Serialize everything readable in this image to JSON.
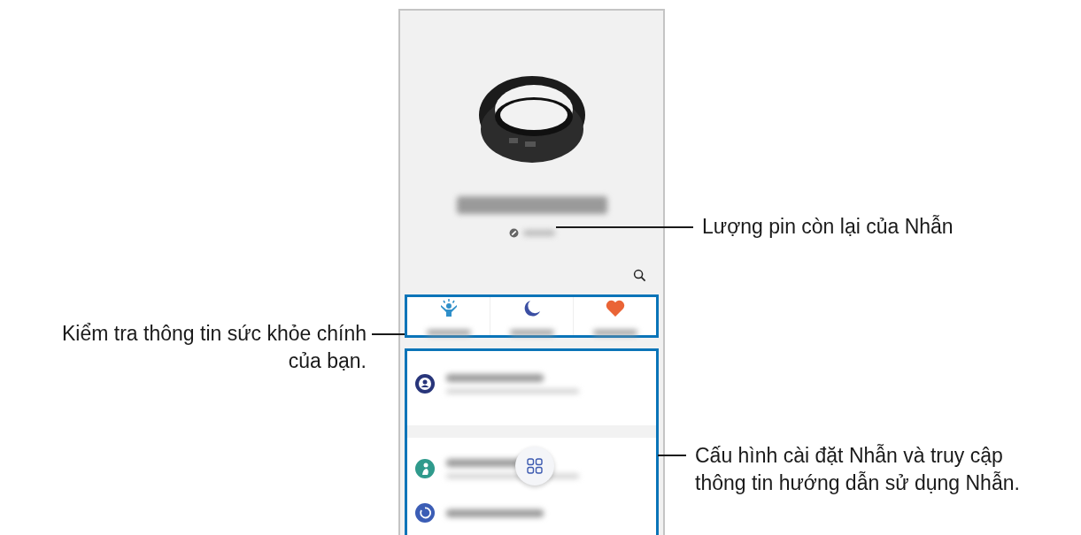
{
  "callouts": {
    "battery": {
      "lines": [
        "Lượng pin còn lại của Nhẫn"
      ]
    },
    "health": {
      "lines": [
        "Kiểm tra thông tin sức khỏe chính",
        "của bạn."
      ]
    },
    "settings": {
      "lines": [
        "Cấu hình cài đặt Nhẫn và truy cập",
        "thông tin hướng dẫn sử dụng Nhẫn."
      ]
    }
  },
  "phone": {
    "health_tiles": [
      {
        "kind": "energy"
      },
      {
        "kind": "sleep"
      },
      {
        "kind": "heart"
      }
    ],
    "settings_items": [
      {
        "kind": "account"
      },
      {
        "kind": "health"
      },
      {
        "kind": "reset"
      }
    ]
  }
}
